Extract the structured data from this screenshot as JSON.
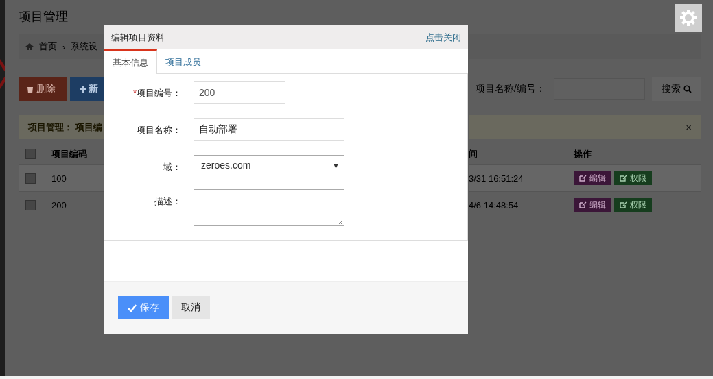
{
  "page": {
    "title": "项目管理",
    "breadcrumb": {
      "items": [
        "首页",
        "系统设"
      ],
      "separator": "›"
    },
    "toolbar": {
      "delete_label": "删除",
      "new_label": "新",
      "search_label": "项目名称/编号：",
      "search_button": "搜索"
    },
    "alert": {
      "title": "项目管理：",
      "text": "项目编",
      "close": "×"
    },
    "table": {
      "columns": [
        "项目编码",
        "间",
        "操作"
      ],
      "header_checked": false,
      "rows": [
        {
          "checked": false,
          "code": "100",
          "time": "3/31 16:51:24",
          "actions": [
            "编辑",
            "权限"
          ]
        },
        {
          "checked": false,
          "code": "200",
          "time": "4/6 14:48:54",
          "actions": [
            "编辑",
            "权限"
          ]
        }
      ]
    }
  },
  "dialog": {
    "title": "编辑项目资料",
    "close": "点击关闭",
    "tabs": [
      {
        "label": "基本信息",
        "selected": true
      },
      {
        "label": "项目成员",
        "selected": false
      }
    ],
    "fields": [
      {
        "kind": "short_text",
        "label": "项目编号：",
        "required_mark": "*",
        "value": "200"
      },
      {
        "kind": "text",
        "label": "项目名称：",
        "value": "自动部署"
      },
      {
        "kind": "select",
        "label": "域：",
        "value": "zeroes.com",
        "arrow": "▾"
      },
      {
        "kind": "textarea",
        "label": "描述："
      }
    ],
    "buttons": [
      {
        "kind": "primary",
        "label": "保存"
      },
      {
        "kind": "default",
        "label": "取消"
      }
    ]
  }
}
